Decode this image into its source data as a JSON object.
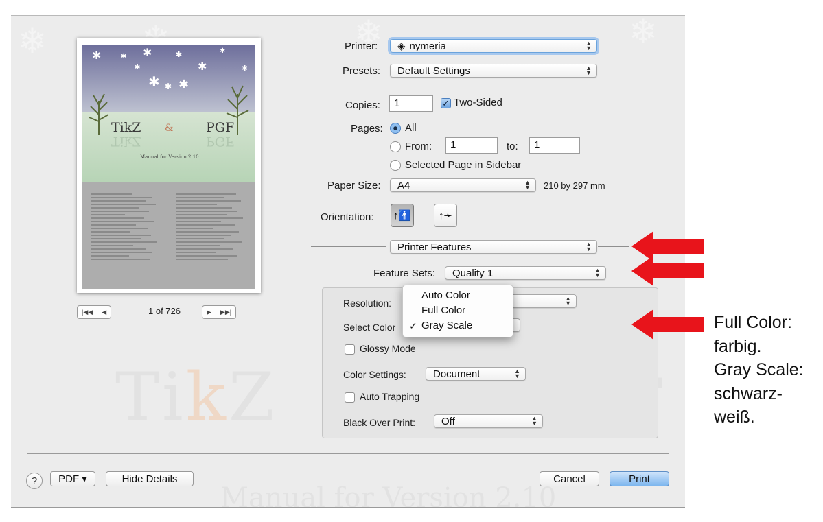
{
  "preview": {
    "cover_title_left": "TikZ",
    "cover_title_right": "PGF",
    "cover_subtitle": "Manual for Version 2.10",
    "page_count": "1 of 726",
    "pager_first": "|◀◀",
    "pager_prev": "◀",
    "pager_next": "▶",
    "pager_last": "▶▶|"
  },
  "watermark": {
    "tikz_a": "Ti",
    "tikz_k": "k",
    "tikz_b": "Z",
    "pgf": "PGF",
    "manual": "Manual for Version 2.10"
  },
  "printer": {
    "label": "Printer:",
    "value": "nymeria"
  },
  "presets": {
    "label": "Presets:",
    "value": "Default Settings"
  },
  "copies": {
    "label": "Copies:",
    "value": "1",
    "two_sided_label": "Two-Sided",
    "two_sided_checked": true
  },
  "pages": {
    "label": "Pages:",
    "all_label": "All",
    "from_label": "From:",
    "from_value": "1",
    "to_label": "to:",
    "to_value": "1",
    "selected_label": "Selected Page in Sidebar",
    "selected_option": "All"
  },
  "paper": {
    "label": "Paper Size:",
    "value": "A4",
    "dimensions": "210 by 297 mm"
  },
  "orientation": {
    "label": "Orientation:",
    "selected": "portrait"
  },
  "section_popup": {
    "value": "Printer Features"
  },
  "feature_sets": {
    "label": "Feature Sets:",
    "value": "Quality 1"
  },
  "features": {
    "resolution_label": "Resolution:",
    "select_color_label": "Select Color",
    "glossy_label": "Glossy Mode",
    "color_settings_label": "Color Settings:",
    "color_settings_value": "Document",
    "auto_trapping_label": "Auto Trapping",
    "black_over_print_label": "Black Over Print:",
    "black_over_print_value": "Off"
  },
  "color_menu": {
    "items": [
      "Auto Color",
      "Full Color",
      "Gray Scale"
    ],
    "checked": "Gray Scale",
    "checkmark": "✓"
  },
  "footer": {
    "help": "?",
    "pdf": "PDF ▾",
    "hide_details": "Hide Details",
    "cancel": "Cancel",
    "print": "Print"
  },
  "annotation": {
    "lines": [
      "Full Color:",
      "farbig.",
      "Gray Scale:",
      "schwarz-",
      "weiß."
    ]
  },
  "colors": {
    "arrow": "#e8141b",
    "focus_ring": "#a7c8ee",
    "primary_button": "#7db6ee"
  }
}
